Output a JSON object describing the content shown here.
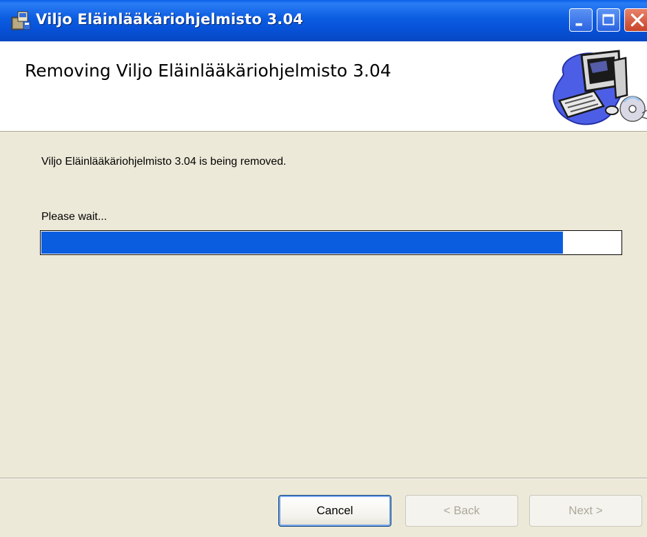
{
  "window": {
    "title": "Viljo Eläinlääkäriohjelmisto 3.04",
    "icon": "installer-package-icon"
  },
  "titlebar_buttons": {
    "minimize": "minimize-icon",
    "maximize": "maximize-icon",
    "close": "close-icon"
  },
  "header": {
    "title": "Removing Viljo Eläinlääkäriohjelmisto 3.04",
    "graphic": "computer-cd-icon"
  },
  "body": {
    "status_text": "Viljo Eläinlääkäriohjelmisto 3.04 is being removed.",
    "wait_text": "Please wait..."
  },
  "progress": {
    "value": 0.9,
    "fill_color": "#0b5de0"
  },
  "buttons": {
    "cancel": "Cancel",
    "back": "< Back",
    "next": "Next >"
  },
  "colors": {
    "titlebar": "#0752d8",
    "dialog_background": "#ece9d8",
    "header_background": "#ffffff"
  }
}
